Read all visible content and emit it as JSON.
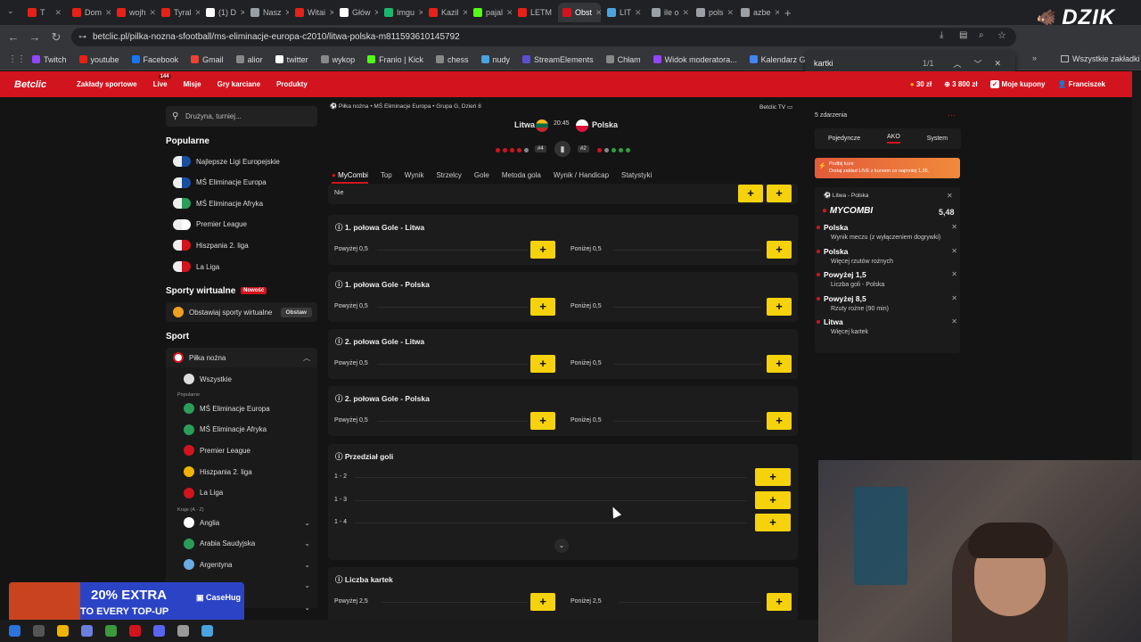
{
  "browser": {
    "tabs": [
      {
        "label": "T",
        "color": "#e62117"
      },
      {
        "label": "Dom",
        "color": "#e62117"
      },
      {
        "label": "wojh",
        "color": "#e62117"
      },
      {
        "label": "Tyral",
        "color": "#e62117"
      },
      {
        "label": "(1) D",
        "color": "#ffffff"
      },
      {
        "label": "Nasz",
        "color": "#9aa0a6"
      },
      {
        "label": "Witai",
        "color": "#e62117"
      },
      {
        "label": "Głów",
        "color": "#ffffff"
      },
      {
        "label": "Imgu",
        "color": "#1bb76e"
      },
      {
        "label": "Kazil",
        "color": "#e62117"
      },
      {
        "label": "pajal",
        "color": "#53fc18"
      },
      {
        "label": "LETM",
        "color": "#e62117"
      },
      {
        "label": "Obst",
        "color": "#d2141e",
        "active": true
      },
      {
        "label": "LIT",
        "color": "#4aa3df"
      },
      {
        "label": "ile o",
        "color": "#9aa0a6"
      },
      {
        "label": "pols",
        "color": "#9aa0a6"
      },
      {
        "label": "azbe",
        "color": "#9aa0a6"
      }
    ],
    "url": "betclic.pl/pilka-nozna-sfootball/ms-eliminacje-europa-c2010/litwa-polska-m811593610145792",
    "bookmarks": [
      "Twitch",
      "youtube",
      "Facebook",
      "Gmail",
      "alior",
      "twitter",
      "wykop",
      "Franio | Kick",
      "chess",
      "nudy",
      "StreamElements",
      "Chłam",
      "Widok moderatora...",
      "Kalendarz Google -..."
    ],
    "bookmarks_right": "Wszystkie zakładki",
    "find": {
      "query": "kartki",
      "count": "1/1"
    }
  },
  "watermark": "DZIK",
  "site": {
    "logo": "Betclic",
    "nav": [
      "Zakłady sportowe",
      "Live",
      "Misje",
      "Gry karciane",
      "Produkty"
    ],
    "live_badge": "144",
    "balance1": "30 zł",
    "balance2": "3 800 zł",
    "coupons": "Moje kupony",
    "user": "Franciszek"
  },
  "sidebar": {
    "search_placeholder": "Drużyna, turniej...",
    "popular_heading": "Popularne",
    "popular": [
      "Najlepsze Ligi Europejskie",
      "MŚ Eliminacje Europa",
      "MŚ Eliminacje Afryka",
      "Premier League",
      "Hiszpania 2. liga",
      "La Liga"
    ],
    "virtual_heading": "Sporty wirtualne",
    "virtual_badge": "Nowość",
    "virtual_item": "Obstawiaj sporty wirtualne",
    "virtual_button": "Obstaw",
    "sport_heading": "Sport",
    "football": "Piłka nożna",
    "all": "Wszystkie",
    "popular_small": "Popularne",
    "sub": [
      "MŚ Eliminacje Europa",
      "MŚ Eliminacje Afryka",
      "Premier League",
      "Hiszpania 2. liga",
      "La Liga"
    ],
    "countries_small": "Kraje (A - Z)",
    "countries": [
      "Anglia",
      "Arabia Saudyjska",
      "Argentyna"
    ]
  },
  "match": {
    "breadcrumb": "Piłka nożna • MŚ Eliminacje Europa • Grupa G, Dzień 8",
    "tv": "Betclic TV",
    "home": "Litwa",
    "away": "Polska",
    "time": "20:45",
    "home_rank": "#4",
    "away_rank": "#2",
    "tabs": [
      "MyCombi",
      "Top",
      "Wynik",
      "Strzelcy",
      "Gole",
      "Metoda gola",
      "Wynik / Handicap",
      "Statystyki"
    ],
    "top_row_label": "Nie",
    "markets": [
      {
        "title": "1. połowa Gole - Litwa",
        "left": "Powyżej 0,5",
        "right": "Poniżej 0,5"
      },
      {
        "title": "1. połowa Gole - Polska",
        "left": "Powyżej 0,5",
        "right": "Poniżej 0,5"
      },
      {
        "title": "2. połowa Gole - Litwa",
        "left": "Powyżej 0,5",
        "right": "Poniżej 0,5"
      },
      {
        "title": "2. połowa Gole - Polska",
        "left": "Powyżej 0,5",
        "right": "Poniżej 0,5"
      }
    ],
    "range_market": {
      "title": "Przedział goli",
      "rows": [
        "1 - 2",
        "1 - 3",
        "1 - 4"
      ]
    },
    "cards_market": {
      "title": "Liczba kartek",
      "left": "Powyżej 2,5",
      "right": "Poniżej 2,5"
    },
    "plus": "+"
  },
  "betslip": {
    "count": "5 zdarzenia",
    "tabs": [
      "Pojedyncze",
      "AKO",
      "System"
    ],
    "boost_title": "Podbij kurs:",
    "boost_text": "Dodaj zakład LIVE z kursem co najmniej 1,35.",
    "event": "Litwa - Polska",
    "combi": "MYCOMBI",
    "odds": "5,48",
    "selections": [
      {
        "title": "Polska",
        "sub": "Wynik meczu (z wyłączeniem dogrywki)"
      },
      {
        "title": "Polska",
        "sub": "Więcej rzutów rożnych"
      },
      {
        "title": "Powyżej 1,5",
        "sub": "Liczba goli - Polska"
      },
      {
        "title": "Powyżej 8,5",
        "sub": "Rzuty rożne (90 min)"
      },
      {
        "title": "Litwa",
        "sub": "Więcej kartek"
      }
    ]
  },
  "promo": {
    "line1": "20% EXTRA",
    "line2": "TO EVERY TOP-UP",
    "brand": "CaseHug"
  }
}
